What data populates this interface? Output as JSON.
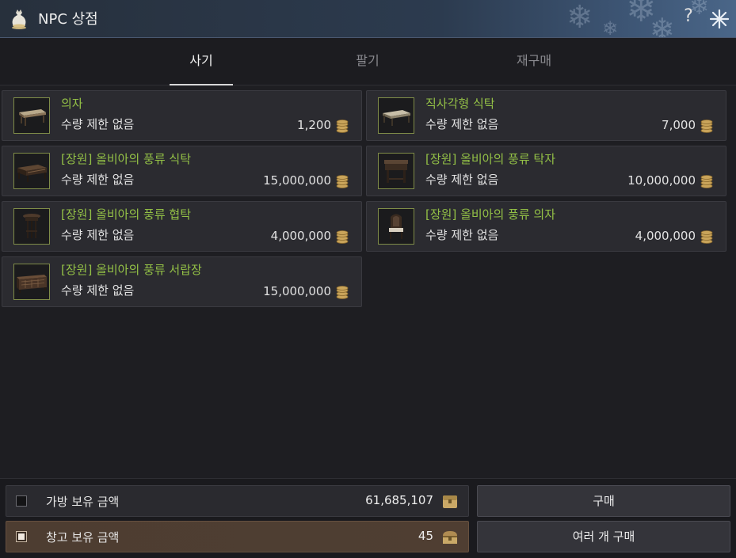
{
  "window": {
    "title": "NPC 상점",
    "help_label": "?"
  },
  "tabs": [
    {
      "label": "사기",
      "active": true
    },
    {
      "label": "팔기",
      "active": false
    },
    {
      "label": "재구매",
      "active": false
    }
  ],
  "items": [
    {
      "name": "의자",
      "limit": "수량 제한 없음",
      "price": "1,200",
      "icon": "wooden-bench-icon"
    },
    {
      "name": "직사각형 식탁",
      "limit": "수량 제한 없음",
      "price": "7,000",
      "icon": "rectangular-table-icon"
    },
    {
      "name": "[장원] 올비아의 풍류 식탁",
      "limit": "수량 제한 없음",
      "price": "15,000,000",
      "icon": "dining-table-icon"
    },
    {
      "name": "[장원] 올비아의 풍류 탁자",
      "limit": "수량 제한 없음",
      "price": "10,000,000",
      "icon": "console-table-icon"
    },
    {
      "name": "[장원] 올비아의 풍류 협탁",
      "limit": "수량 제한 없음",
      "price": "4,000,000",
      "icon": "side-table-icon"
    },
    {
      "name": "[장원] 올비아의 풍류 의자",
      "limit": "수량 제한 없음",
      "price": "4,000,000",
      "icon": "chair-icon"
    },
    {
      "name": "[장원] 올비아의 풍류 서랍장",
      "limit": "수량 제한 없음",
      "price": "15,000,000",
      "icon": "drawer-cabinet-icon"
    }
  ],
  "footer": {
    "bag": {
      "label": "가방 보유 금액",
      "amount": "61,685,107",
      "checked": false
    },
    "storage": {
      "label": "창고 보유 금액",
      "amount": "45",
      "checked": true
    },
    "buy_label": "구매",
    "buy_multiple_label": "여러 개 구매"
  },
  "colors": {
    "item_name": "#93c046",
    "thumb_border": "#7f8c48",
    "storage_row": "#4d3d31",
    "titlebar": "#2c3b4f"
  }
}
